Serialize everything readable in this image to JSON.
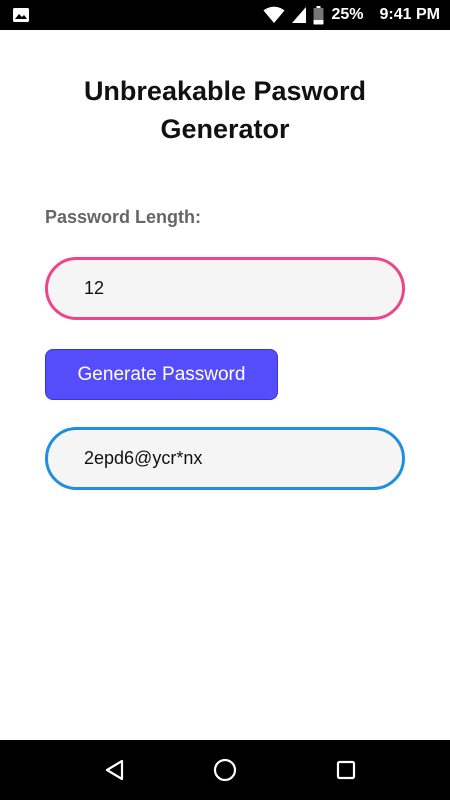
{
  "status_bar": {
    "left_icon": "image-notification-icon",
    "icons": [
      "wifi-icon",
      "signal-icon",
      "battery-icon"
    ],
    "battery": "25%",
    "time": "9:41 PM"
  },
  "app": {
    "title": "Unbreakable Pasword Generator",
    "length_label": "Password Length:",
    "length_value": "12",
    "generate_button_label": "Generate Password",
    "generated_password": "2epd6@ycr*nx"
  },
  "colors": {
    "length_field_border": "#ef4588",
    "output_field_border": "#1f8fe0",
    "button_background": "#564dfa",
    "field_background": "#f5f5f5"
  },
  "nav_bar": {
    "buttons": [
      "back-icon",
      "home-icon",
      "recents-icon"
    ]
  }
}
